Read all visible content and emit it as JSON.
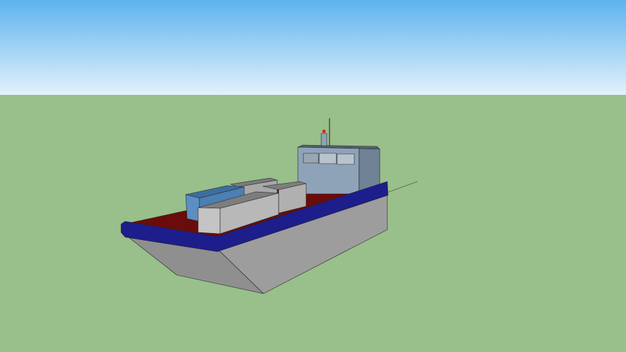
{
  "scene": {
    "colors": {
      "sky_top": "#5db3ee",
      "sky_bottom": "#e3f1fb",
      "ground": "#99bf8b",
      "hull": "#8f8f8f",
      "hull_side": "#a3a3a3",
      "gunwale": "#1d1d8c",
      "deck": "#6b0c0c",
      "cabin": "#8fa3b8",
      "cabin_side": "#6f8296",
      "container_grey": "#b8b8b8",
      "container_blue": "#5b8fc4",
      "beacon": "#e02020"
    }
  }
}
